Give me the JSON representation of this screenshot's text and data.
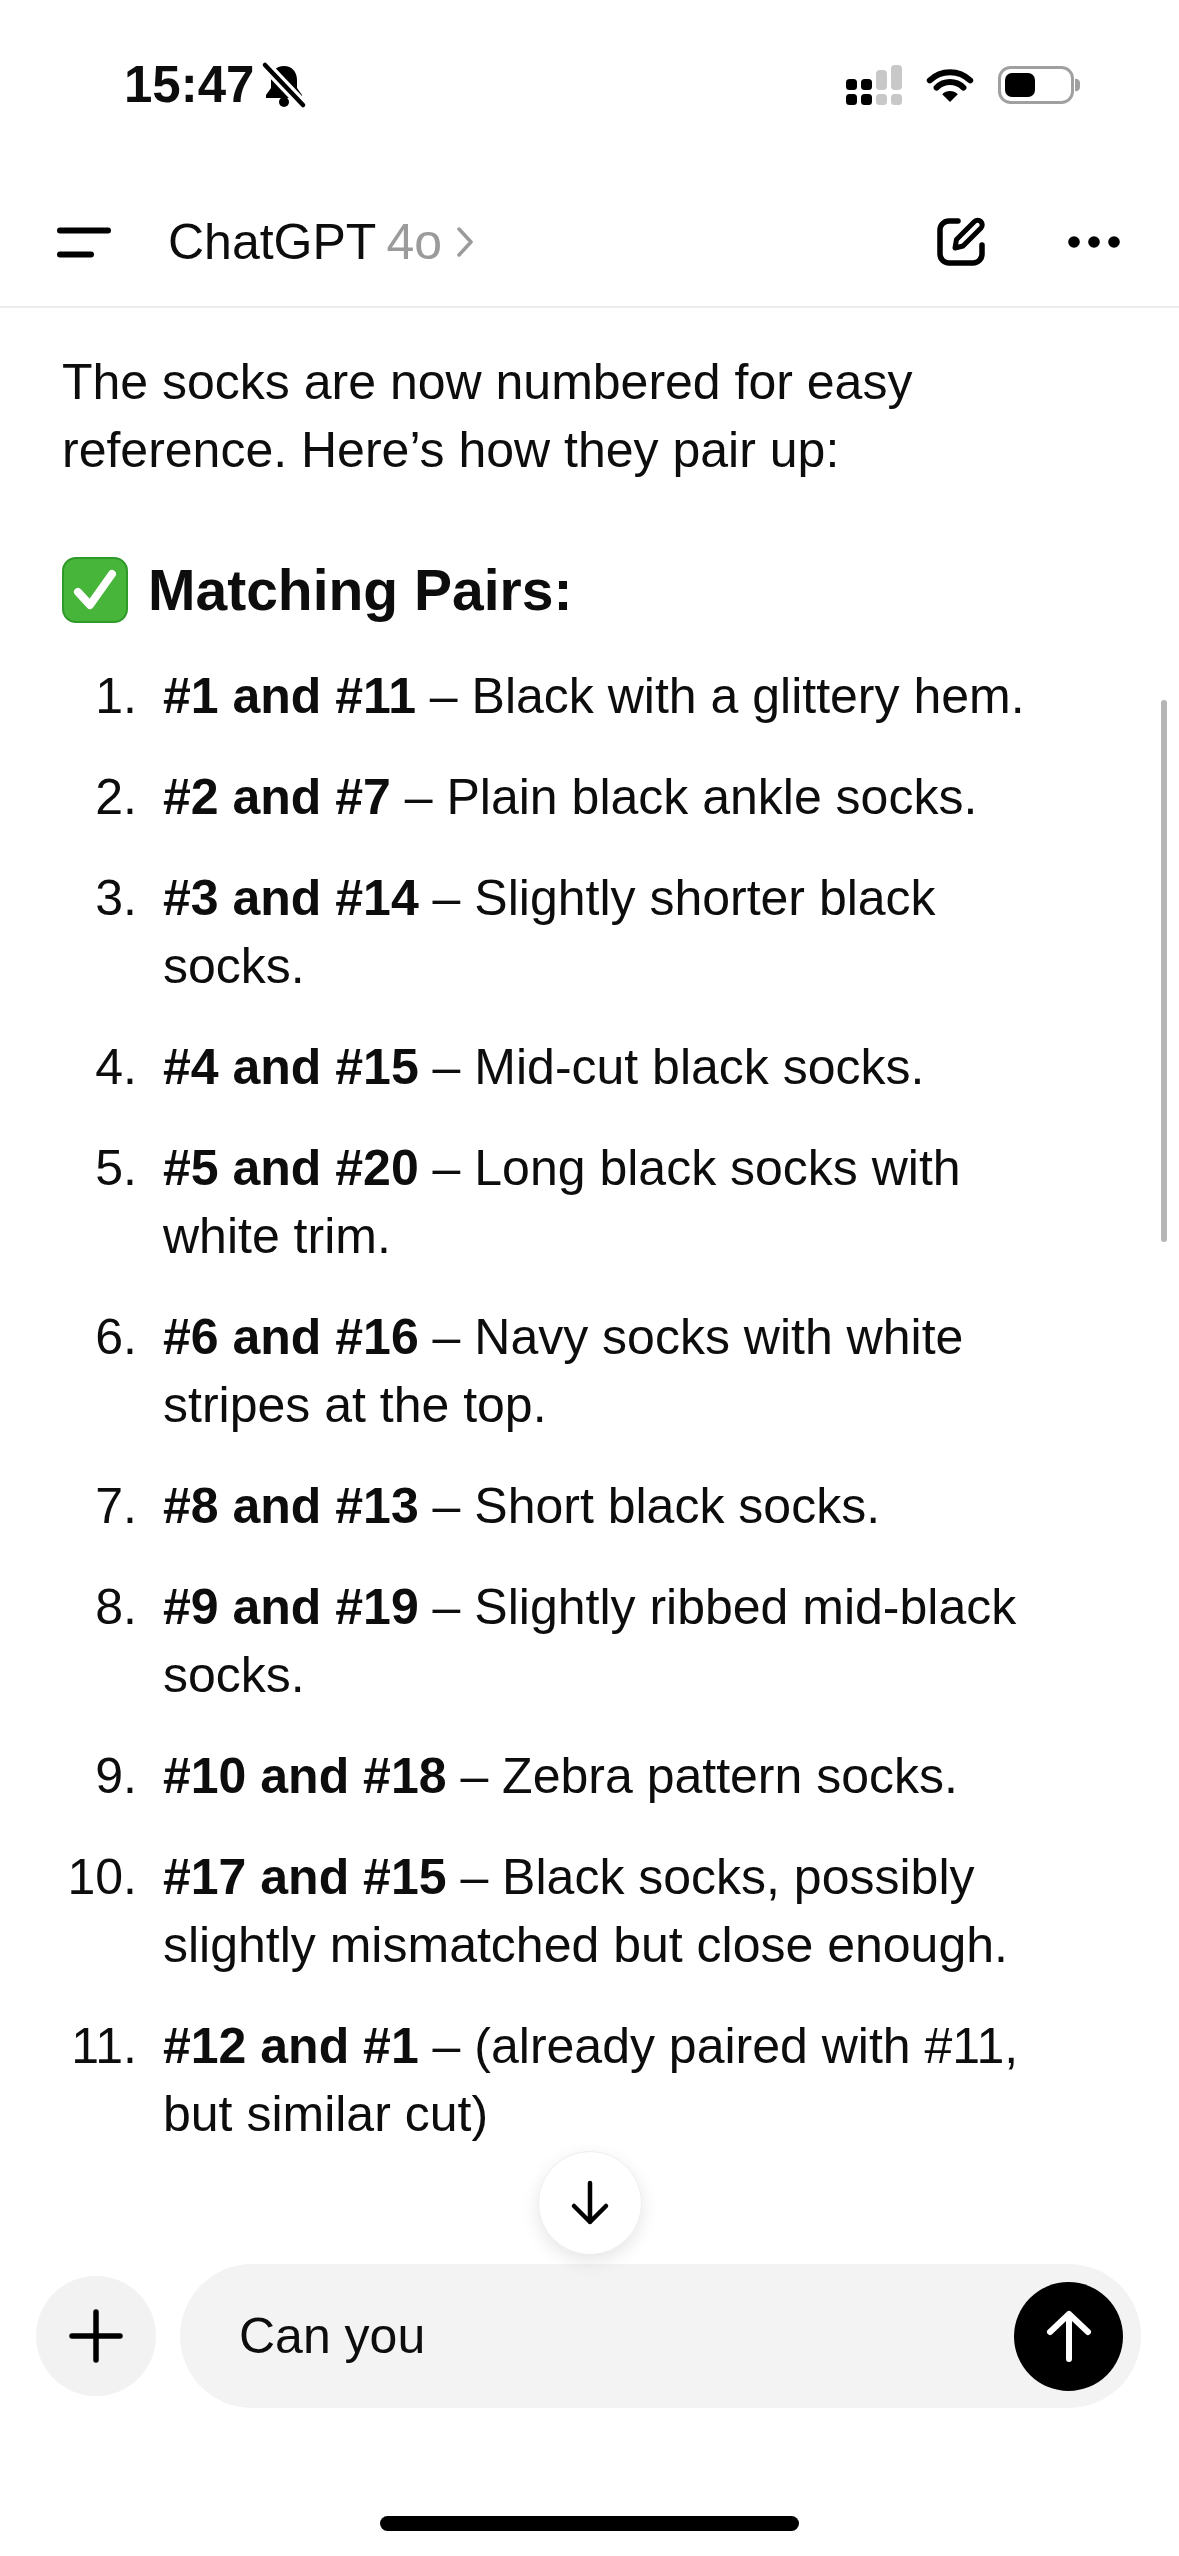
{
  "status_bar": {
    "time": "15:47"
  },
  "header": {
    "title": "ChatGPT",
    "model": "4o"
  },
  "message": {
    "intro": "The socks are now numbered for easy reference. Here’s how they pair up:",
    "heading": "Matching Pairs:",
    "items": [
      {
        "number": "1.",
        "text": "**#1 and #11** – Black with a glittery hem."
      },
      {
        "number": "2.",
        "text": "**#2 and #7** – Plain black ankle socks."
      },
      {
        "number": "3.",
        "text": "**#3 and #14** – Slightly shorter black socks."
      },
      {
        "number": "4.",
        "text": "**#4 and #15** – Mid-cut black socks."
      },
      {
        "number": "5.",
        "text": "**#5 and #20** – Long black socks with white trim."
      },
      {
        "number": "6.",
        "text": "**#6 and #16** – Navy socks with white stripes at the top."
      },
      {
        "number": "7.",
        "text": "**#8 and #13** – Short black socks."
      },
      {
        "number": "8.",
        "text": "**#9 and #19** – Slightly ribbed mid-black socks."
      },
      {
        "number": "9.",
        "text": "**#10 and #18** – Zebra pattern socks."
      },
      {
        "number": "10.",
        "text": "**#17 and #15** – Black socks, possibly slightly mismatched but close enough."
      },
      {
        "number": "11.",
        "text": "**#12 and #1** – (already paired with #11, but similar cut)"
      }
    ]
  },
  "composer": {
    "value": "Can you"
  }
}
